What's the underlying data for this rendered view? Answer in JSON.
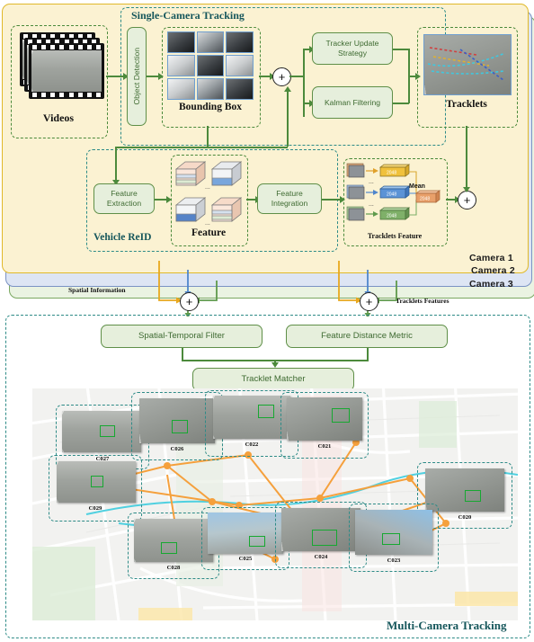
{
  "diagram": {
    "single_camera": {
      "title": "Single-Camera Tracking",
      "videos_label": "Videos",
      "object_detection_label": "Object Detection",
      "bounding_box_label": "Bounding Box",
      "tracker_update_label": "Tracker Update Strategy",
      "kalman_label": "Kalman Filtering",
      "tracklets_label": "Tracklets",
      "plus_symbol": "+"
    },
    "vehicle_reid": {
      "title": "Vehicle ReID",
      "feature_extraction_label": "Feature Extraction",
      "feature_label": "Feature",
      "feature_integration_label": "Feature Integration",
      "tracklets_feature_label": "Tracklets Feature",
      "mean_label": "Mean",
      "vector_dim": "2048",
      "ellipsis": "...",
      "plus_symbol": "+"
    },
    "camera_layers": [
      {
        "label": "Camera 1",
        "color": "#fbf2d2",
        "border": "#e0b92b"
      },
      {
        "label": "Camera 2",
        "color": "#dde5f4",
        "border": "#7b93c4"
      },
      {
        "label": "Camera 3",
        "color": "#eaf3e2",
        "border": "#7aa861"
      }
    ],
    "bus_labels": {
      "spatial_information": "Spatial Information",
      "tracklets_features": "Tracklets Features",
      "plus_symbol": "+"
    },
    "multi_camera": {
      "title": "Multi-Camera Tracking",
      "spatial_temporal_filter_label": "Spatial-Temporal Filter",
      "feature_distance_metric_label": "Feature Distance Metric",
      "tracklet_matcher_label": "Tracklet Matcher",
      "cameras": [
        {
          "id": "C027"
        },
        {
          "id": "C026"
        },
        {
          "id": "C022"
        },
        {
          "id": "C021"
        },
        {
          "id": "C029"
        },
        {
          "id": "C020"
        },
        {
          "id": "C028"
        },
        {
          "id": "C025"
        },
        {
          "id": "C024"
        },
        {
          "id": "C023"
        }
      ]
    },
    "colors": {
      "green_accent": "#4c8a3c",
      "teal_title": "#15565b",
      "orange_link": "#f5a03c",
      "cyan_link": "#4fd0e0",
      "bbox_green": "#17a831",
      "yellow_vector": "#f0c13c",
      "blue_vector": "#5b93d6",
      "green_vector": "#7fb069",
      "orange_vector": "#e8a06a"
    }
  }
}
